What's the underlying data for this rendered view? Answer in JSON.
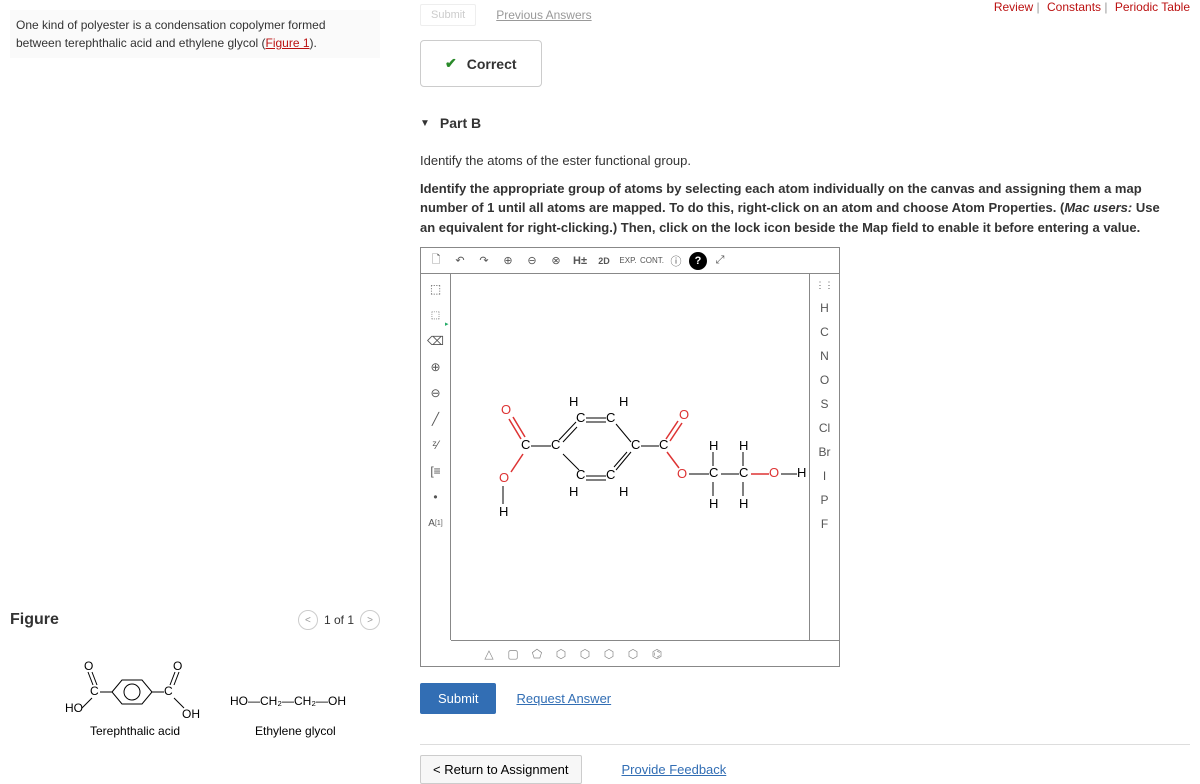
{
  "top": {
    "review": "Review",
    "constants": "Constants",
    "periodic": "Periodic Table"
  },
  "intro": {
    "text_a": "One kind of polyester is a condensation copolymer formed between terephthalic acid and ethylene glycol (",
    "figure_link": "Figure 1",
    "text_b": ")."
  },
  "part_a": {
    "submit": "Submit",
    "previous_answers": "Previous Answers",
    "correct": "Correct"
  },
  "part_b": {
    "title": "Part B",
    "line1": "Identify the atoms of the ester functional group.",
    "line2_a": "Identify the appropriate group of atoms by selecting each atom individually on the canvas and assigning them a map number of 1 until all atoms are mapped. To do this, right-click on an atom and choose Atom Properties.  (",
    "line2_mac": "Mac users:",
    "line2_b": " Use an equivalent for right-clicking.) Then, click on the lock icon beside the Map field to enable it before entering a value."
  },
  "editor": {
    "top_tools": [
      "🗋",
      "↶",
      "↷",
      "⊕",
      "⊖",
      "⊗",
      "H±",
      "2D",
      "EXP.",
      "CONT.",
      "ⓘ",
      "?",
      "⤢"
    ],
    "left_tools": [
      "⬚",
      "⬚",
      "⌫",
      "⊕",
      "⊖",
      "╱",
      "ᶻ⁄",
      "[≡",
      "•",
      "A[1]"
    ],
    "right_tools": [
      "⋮⋮",
      "H",
      "C",
      "N",
      "O",
      "S",
      "Cl",
      "Br",
      "I",
      "P",
      "F"
    ],
    "bottom_tools": [
      "△",
      "▢",
      "⬠",
      "⬡",
      "⬡",
      "⬡",
      "⬡",
      "⌬"
    ]
  },
  "actions": {
    "submit": "Submit",
    "request_answer": "Request Answer",
    "return": "< Return to Assignment",
    "feedback": "Provide Feedback"
  },
  "figure": {
    "title": "Figure",
    "counter": "1 of 1",
    "terephthalic": "Terephthalic acid",
    "ethylene": "Ethylene glycol",
    "ho": "HO",
    "oh": "OH",
    "eth_formula": "HO—CH₂—CH₂—OH"
  }
}
